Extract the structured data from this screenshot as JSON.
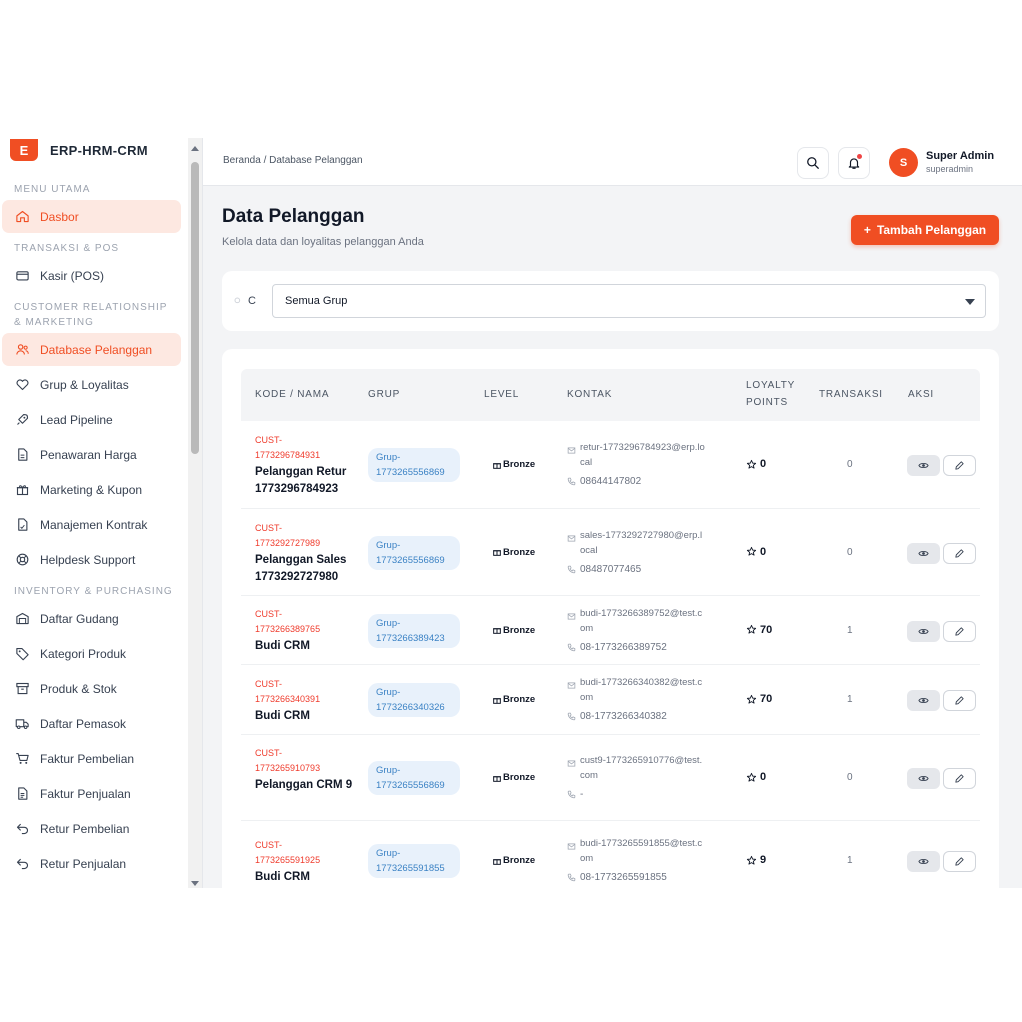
{
  "brand": {
    "logo_letter": "E",
    "name": "ERP-HRM-CRM"
  },
  "sidebar": {
    "sections": [
      {
        "title": "MENU UTAMA",
        "items": [
          {
            "label": "Dasbor",
            "icon": "home-icon",
            "active": true
          }
        ]
      },
      {
        "title": "TRANSAKSI & POS",
        "items": [
          {
            "label": "Kasir (POS)",
            "icon": "credit-card-icon"
          }
        ]
      },
      {
        "title": "CUSTOMER RELATIONSHIP & MARKETING",
        "items": [
          {
            "label": "Database Pelanggan",
            "icon": "users-icon",
            "active": true
          },
          {
            "label": "Grup & Loyalitas",
            "icon": "heart-icon"
          },
          {
            "label": "Lead Pipeline",
            "icon": "rocket-icon"
          },
          {
            "label": "Penawaran Harga",
            "icon": "document-icon"
          },
          {
            "label": "Marketing & Kupon",
            "icon": "gift-icon"
          },
          {
            "label": "Manajemen Kontrak",
            "icon": "contract-icon"
          },
          {
            "label": "Helpdesk Support",
            "icon": "lifebuoy-icon"
          }
        ]
      },
      {
        "title": "INVENTORY & PURCHASING",
        "items": [
          {
            "label": "Daftar Gudang",
            "icon": "warehouse-icon"
          },
          {
            "label": "Kategori Produk",
            "icon": "tag-icon"
          },
          {
            "label": "Produk & Stok",
            "icon": "archive-icon"
          },
          {
            "label": "Daftar Pemasok",
            "icon": "truck-icon"
          },
          {
            "label": "Faktur Pembelian",
            "icon": "cart-icon"
          },
          {
            "label": "Faktur Penjualan",
            "icon": "invoice-icon"
          },
          {
            "label": "Retur Pembelian",
            "icon": "return-icon"
          },
          {
            "label": "Retur Penjualan",
            "icon": "return-icon"
          }
        ]
      }
    ]
  },
  "header": {
    "breadcrumb": "Beranda / Database Pelanggan",
    "user_initial": "S",
    "user_name": "Super Admin",
    "user_role": "superadmin"
  },
  "page": {
    "title": "Data Pelanggan",
    "subtitle": "Kelola data dan loyalitas pelanggan Anda",
    "add_button": "Tambah Pelanggan",
    "add_button_icon": "+",
    "search_placeholder": "C",
    "group_filter": "Semua Grup"
  },
  "table": {
    "headers": [
      "KODE / NAMA",
      "GRUP",
      "LEVEL",
      "KONTAK",
      "LOYALTY POINTS",
      "TRANSAKSI",
      "AKSI"
    ],
    "rows": [
      {
        "code": "CUST-1773296784931",
        "name": "Pelanggan Retur 1773296784923",
        "group": "Grup-1773265556869",
        "level": "Bronze",
        "email": "retur-1773296784923@erp.local",
        "phone": "08644147802",
        "points": "0",
        "transactions": "0"
      },
      {
        "code": "CUST-1773292727989",
        "name": "Pelanggan Sales 1773292727980",
        "group": "Grup-1773265556869",
        "level": "Bronze",
        "email": "sales-1773292727980@erp.local",
        "phone": "08487077465",
        "points": "0",
        "transactions": "0"
      },
      {
        "code": "CUST-1773266389765",
        "name": "Budi CRM",
        "group": "Grup-1773266389423",
        "level": "Bronze",
        "email": "budi-1773266389752@test.com",
        "phone": "08-1773266389752",
        "points": "70",
        "transactions": "1"
      },
      {
        "code": "CUST-1773266340391",
        "name": "Budi CRM",
        "group": "Grup-1773266340326",
        "level": "Bronze",
        "email": "budi-1773266340382@test.com",
        "phone": "08-1773266340382",
        "points": "70",
        "transactions": "1"
      },
      {
        "code": "CUST-1773265910793",
        "name": "Pelanggan CRM 9",
        "group": "Grup-1773265556869",
        "level": "Bronze",
        "email": "cust9-1773265910776@test.com",
        "phone": "-",
        "points": "0",
        "transactions": "0"
      },
      {
        "code": "CUST-1773265591925",
        "name": "Budi CRM",
        "group": "Grup-1773265591855",
        "level": "Bronze",
        "email": "budi-1773265591855@test.com",
        "phone": "08-1773265591855",
        "points": "9",
        "transactions": "1"
      }
    ]
  },
  "colors": {
    "accent": "#f04e23",
    "group_badge_bg": "#e8f1fb",
    "group_badge_text": "#3b82c4",
    "code_text": "#ef3b2c"
  }
}
